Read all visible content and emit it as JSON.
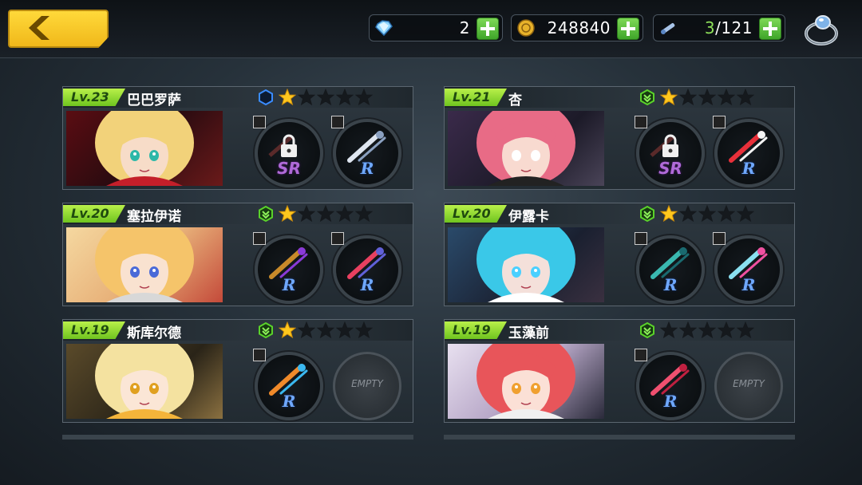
{
  "resources": {
    "gems": "2",
    "gold": "248840",
    "capacity_used": "3",
    "capacity_total": "/121"
  },
  "colors": {
    "accent_yellow": "#f5c21b",
    "level_green": "#8bd43a",
    "plus_green": "#4cb82f",
    "rank_blue": "#3a8cff",
    "rank_green": "#5ad22a",
    "star_gold": "#ffc81e"
  },
  "characters": [
    {
      "level": "Lv.23",
      "name": "巴巴罗萨",
      "rank_icon": "hexagon-icon",
      "stars_filled": 1,
      "stars_total": 5,
      "equip": [
        {
          "rarity": "SR",
          "icon": "locked-weapon-icon"
        },
        {
          "rarity": "R",
          "icon": "twin-blades-icon"
        }
      ]
    },
    {
      "level": "Lv.21",
      "name": "杏",
      "rank_icon": "chevron-rank-icon",
      "stars_filled": 1,
      "stars_total": 5,
      "equip": [
        {
          "rarity": "SR",
          "icon": "locked-weapon-icon"
        },
        {
          "rarity": "R",
          "icon": "red-scythe-icon"
        }
      ]
    },
    {
      "level": "Lv.20",
      "name": "塞拉伊诺",
      "rank_icon": "chevron-rank-icon",
      "stars_filled": 1,
      "stars_total": 5,
      "equip": [
        {
          "rarity": "R",
          "icon": "golden-staff-icon"
        },
        {
          "rarity": "R",
          "icon": "red-blade-icon"
        }
      ]
    },
    {
      "level": "Lv.20",
      "name": "伊露卡",
      "rank_icon": "chevron-rank-icon",
      "stars_filled": 1,
      "stars_total": 5,
      "equip": [
        {
          "rarity": "R",
          "icon": "teal-daggers-icon"
        },
        {
          "rarity": "R",
          "icon": "crystal-sword-icon"
        }
      ]
    },
    {
      "level": "Lv.19",
      "name": "斯库尔德",
      "rank_icon": "chevron-rank-icon",
      "stars_filled": 1,
      "stars_total": 5,
      "equip": [
        {
          "rarity": "R",
          "icon": "orange-staff-icon"
        },
        {
          "empty": "EMPTY"
        }
      ]
    },
    {
      "level": "Lv.19",
      "name": "玉藻前",
      "rank_icon": "chevron-rank-icon",
      "stars_filled": 0,
      "stars_total": 5,
      "equip": [
        {
          "rarity": "R",
          "icon": "pink-creature-icon"
        },
        {
          "empty": "EMPTY"
        }
      ]
    }
  ]
}
